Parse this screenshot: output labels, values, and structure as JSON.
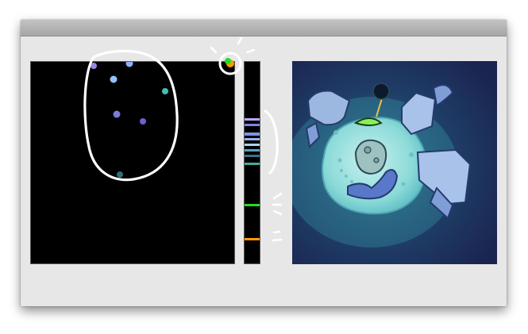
{
  "colors": {
    "window_bg": "#e7e7e7",
    "titlebar": "#b3b3b3",
    "canvas_bg": "#000000",
    "annotation": "#ffffff"
  },
  "icons": {
    "selected_color_indicator": "color-picker-icon",
    "callout_marks": "sparkle-icon"
  },
  "swatch_strip": {
    "swatches": [
      "#b9a9f0",
      "#7a86e0",
      "#8fb4f5",
      "#a7d4f5",
      "#5aa0c8",
      "#3f6f85",
      "#4aa89e",
      "#22dd22",
      "#ff9900"
    ]
  },
  "scatter_points": [
    "#9c86e6",
    "#8fb0f5",
    "#90c3f5",
    "#3fbfb0",
    "#7b7ad6",
    "#6a62c8",
    "#2f6f78"
  ],
  "preview": {
    "image": "cartoon-planet-illustration"
  }
}
